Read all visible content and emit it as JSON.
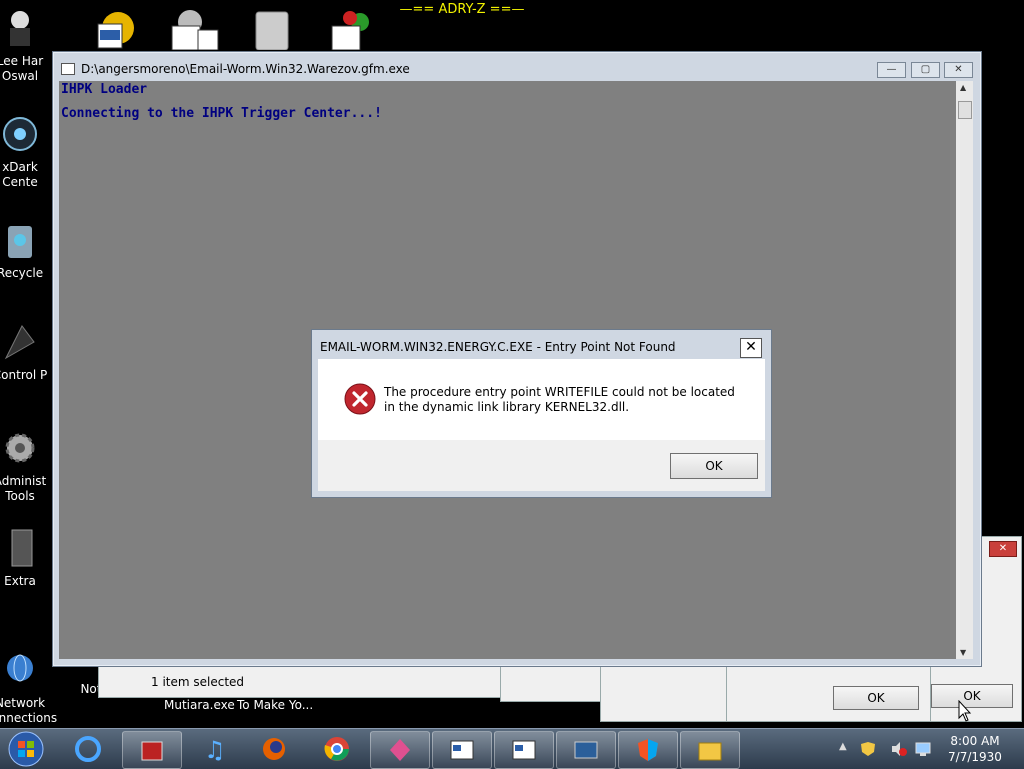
{
  "banner": "—== ADRY-Z ==—",
  "desktop_icons": [
    {
      "label_1": "Lee Har",
      "label_2": "Oswal"
    },
    {
      "label_1": "xDark",
      "label_2": "Cente"
    },
    {
      "label_1": "Recycle",
      "label_2": ""
    },
    {
      "label_1": "Control P",
      "label_2": ""
    },
    {
      "label_1": "Administ",
      "label_2": "Tools"
    },
    {
      "label_1": "Extra",
      "label_2": ""
    },
    {
      "label_1": "Network",
      "label_2": "Connections"
    },
    {
      "label_1": "Notepad++",
      "label_2": ""
    }
  ],
  "bottom_labels": {
    "mutiara": "Mutiara.exe",
    "tomake": "To Make Yo..."
  },
  "explorer_status": "1 item selected",
  "console": {
    "title": "D:\\angersmoreno\\Email-Worm.Win32.Warezov.gfm.exe",
    "line1": "IHPK Loader",
    "line2": "Connecting to the IHPK Trigger Center...!"
  },
  "dialog": {
    "title": "EMAIL-WORM.WIN32.ENERGY.C.EXE - Entry Point Not Found",
    "message": "The procedure entry point WRITEFILE could not be located in the dynamic link library KERNEL32.dll.",
    "ok_label": "OK",
    "close_glyph": "✕"
  },
  "background_buttons": {
    "ok1": "OK",
    "ok2": "OK"
  },
  "window_controls": {
    "minimize": "—",
    "maximize": "▢",
    "close": "✕"
  },
  "clock": {
    "time": "8:00 AM",
    "date": "7/7/1930"
  },
  "taskbar_icons": [
    "windows-start-icon",
    "internet-explorer-icon",
    "archive-icon",
    "music-note-icon",
    "firefox-icon",
    "chrome-icon",
    "star-app-icon",
    "window-app-icon",
    "window-app-icon-2",
    "monitor-icon",
    "shield-icon",
    "folder-icon"
  ],
  "colors": {
    "console_text": "#000080",
    "console_bg": "#808080",
    "banner": "#f2f200",
    "error_red": "#c0262e"
  }
}
